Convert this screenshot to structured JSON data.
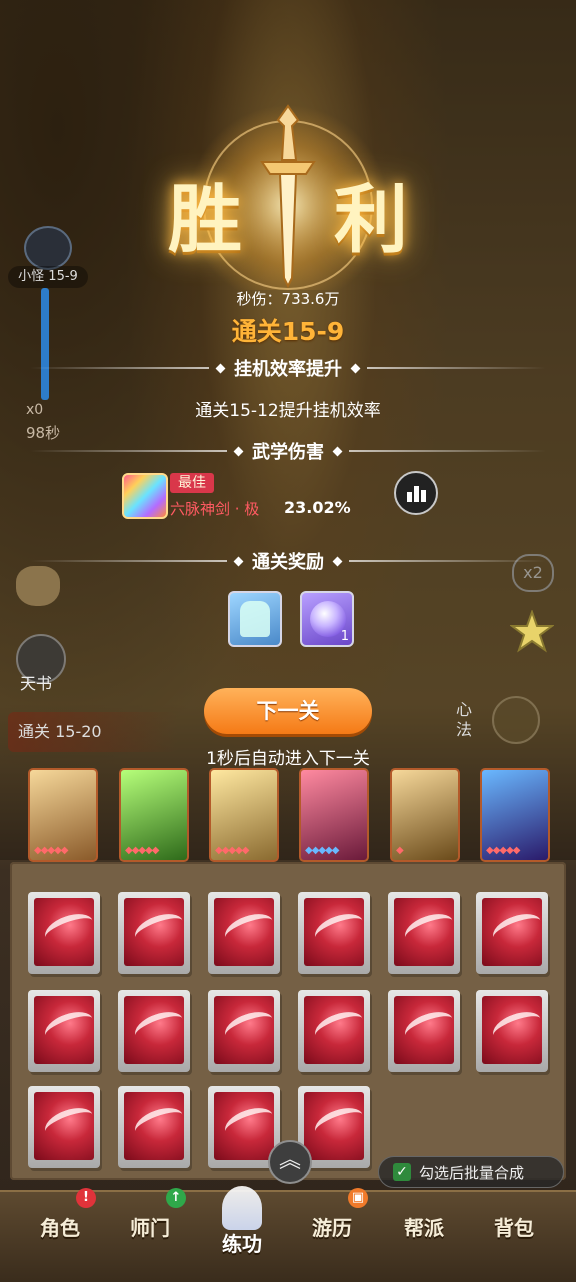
{
  "result": {
    "title_left": "胜",
    "title_right": "利",
    "dps_label": "秒伤：",
    "dps_value": "733.6万",
    "stage_cleared": "通关15-9"
  },
  "sections": {
    "efficiency": {
      "title": "挂机效率提升",
      "text": "通关15-12提升挂机效率"
    },
    "damage": {
      "title": "武学伤害",
      "best_badge": "最佳",
      "skill_name": "六脉神剑 · 极",
      "skill_percent": "23.02%"
    },
    "rewards": {
      "title": "通关奖励",
      "items": [
        {
          "icon": "palm-manual-icon",
          "qty": ""
        },
        {
          "icon": "meditation-orb-icon",
          "qty": "1"
        }
      ]
    }
  },
  "actions": {
    "next_button": "下一关",
    "auto_next_text": "1秒后自动进入下一关"
  },
  "hud": {
    "mob_label": "小怪 15-9",
    "kill_count": "x0",
    "timer": "98秒",
    "book_label": "天书",
    "stage_pill": "通关 15-20",
    "speed": "x2",
    "xinfa": "心法"
  },
  "bag": {
    "merge_label": "勾选后批量合成",
    "merge_checked": true
  },
  "nav": {
    "items": [
      "角色",
      "师门",
      "练功",
      "游历",
      "帮派",
      "背包"
    ],
    "active": "练功"
  },
  "colors": {
    "accent_orange": "#f57a16",
    "stage_gold": "#ffb438",
    "skill_red": "#ff5a62",
    "best_badge": "#d9374a"
  }
}
